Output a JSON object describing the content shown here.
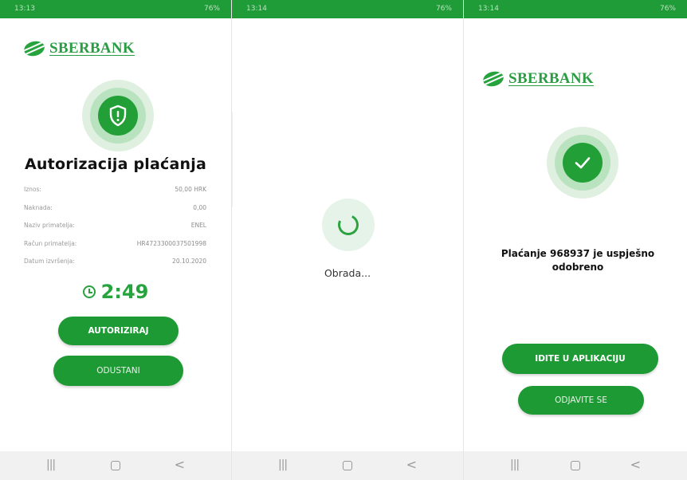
{
  "status_bars": [
    {
      "time": "13:13",
      "right": "76%"
    },
    {
      "time": "13:14",
      "right": "76%"
    },
    {
      "time": "13:14",
      "right": "76%"
    }
  ],
  "brand": {
    "name": "SBERBANK",
    "color": "#2a9c43"
  },
  "screen1": {
    "icon": "shield-alert-icon",
    "title": "Autorizacija plaćanja",
    "details": [
      {
        "label": "Iznos:",
        "value": "50,00 HRK"
      },
      {
        "label": "Naknada:",
        "value": "0,00"
      },
      {
        "label": "Naziv primatelja:",
        "value": "ENEL"
      },
      {
        "label": "Račun primatelja:",
        "value": "HR4723300037501998"
      },
      {
        "label": "Datum izvršenja:",
        "value": "20.10.2020"
      }
    ],
    "timer": "2:49",
    "authorize_label": "AUTORIZIRAJ",
    "cancel_label": "ODUSTANI"
  },
  "screen2": {
    "processing_label": "Obrada..."
  },
  "screen3": {
    "icon": "checkmark-icon",
    "message": "Plaćanje 968937 je uspješno odobreno",
    "go_to_app_label": "IDITE U APLIKACIJU",
    "logout_label": "ODJAVITE SE"
  },
  "navbar": {
    "recents": "|||",
    "back": "<"
  },
  "colors": {
    "status_bar": "#1f9b37",
    "button": "#1e9a35",
    "ring_light": "#dff0e1",
    "ring_mid": "#b9e2bf"
  }
}
